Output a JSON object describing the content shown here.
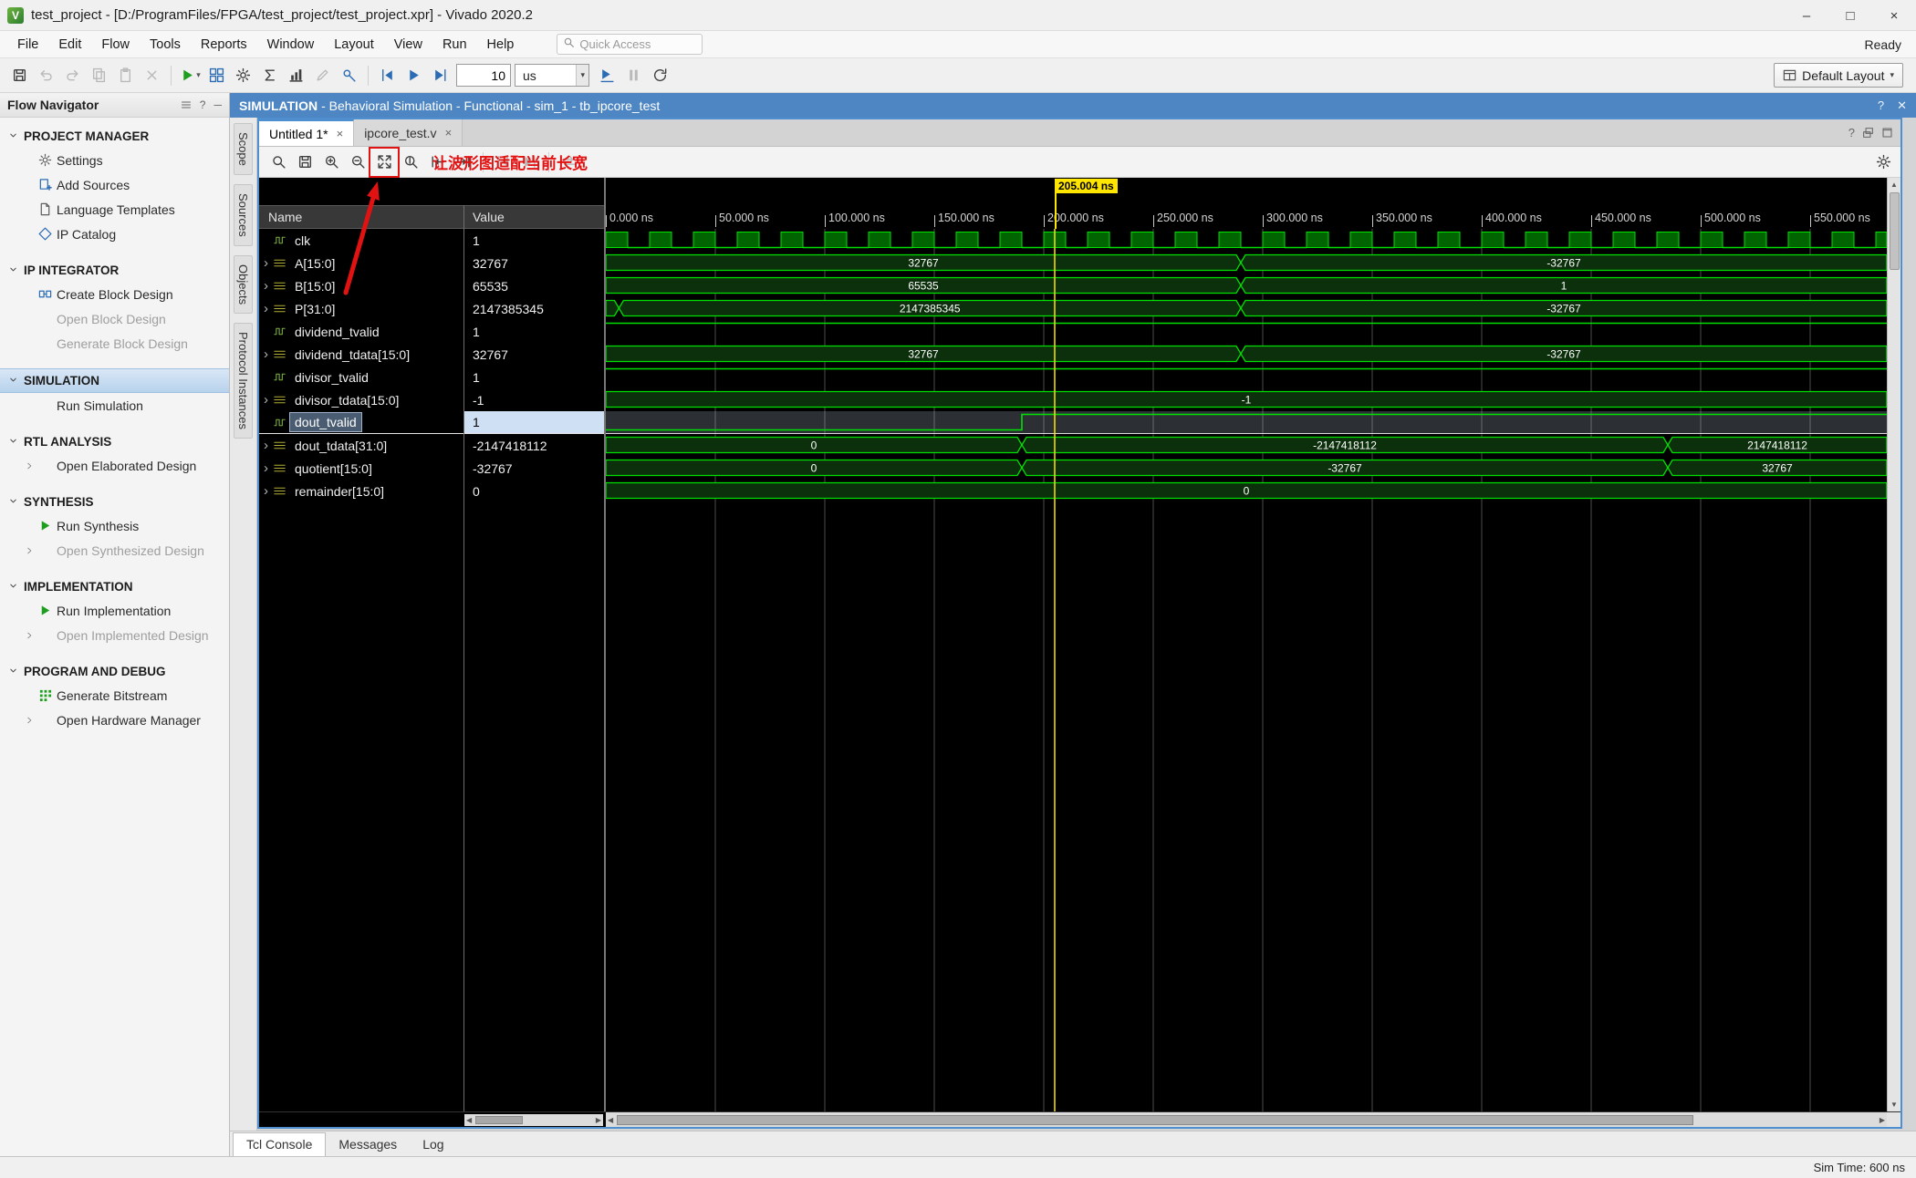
{
  "window": {
    "title": "test_project - [D:/ProgramFiles/FPGA/test_project/test_project.xpr] - Vivado 2020.2",
    "status": "Ready",
    "controls": {
      "minimize": "–",
      "maximize": "□",
      "close": "×"
    }
  },
  "menu": {
    "items": [
      "File",
      "Edit",
      "Flow",
      "Tools",
      "Reports",
      "Window",
      "Layout",
      "View",
      "Run",
      "Help"
    ],
    "quick_access": "Quick Access"
  },
  "toolbar": {
    "sim_time_value": "10",
    "sim_time_unit": "us",
    "layout_label": "Default Layout",
    "buttons": [
      {
        "icon": "save",
        "name": "save"
      },
      {
        "icon": "undo",
        "name": "undo",
        "disabled": true
      },
      {
        "icon": "redo",
        "name": "redo",
        "disabled": true
      },
      {
        "icon": "copy",
        "name": "copy",
        "disabled": true
      },
      {
        "icon": "paste",
        "name": "paste",
        "disabled": true
      },
      {
        "icon": "del",
        "name": "delete",
        "disabled": true
      },
      {
        "sep": true
      },
      {
        "icon": "play",
        "name": "run",
        "color": "green",
        "dropdown": true
      },
      {
        "icon": "dash",
        "name": "dashboard",
        "color": "blue"
      },
      {
        "icon": "gear",
        "name": "settings"
      },
      {
        "icon": "sigma",
        "name": "report-summary"
      },
      {
        "icon": "report",
        "name": "report-metrics"
      },
      {
        "icon": "pencil",
        "name": "edit",
        "disabled": true
      },
      {
        "icon": "probe",
        "name": "probe",
        "color": "blue"
      },
      {
        "sep": true
      },
      {
        "icon": "restart",
        "name": "restart-simulation",
        "color": "blue"
      },
      {
        "icon": "play",
        "name": "run-all",
        "color": "blue"
      },
      {
        "icon": "step",
        "name": "step",
        "color": "blue"
      },
      {
        "input": "10"
      },
      {
        "unit": "us"
      },
      {
        "icon": "runfor",
        "name": "run-for-time",
        "color": "blue"
      },
      {
        "icon": "pause",
        "name": "pause",
        "disabled": true
      },
      {
        "icon": "relaunch",
        "name": "relaunch-simulation"
      }
    ]
  },
  "sim_header": {
    "title": "SIMULATION",
    "subtitle": "- Behavioral Simulation - Functional - sim_1 - tb_ipcore_test"
  },
  "flow_navigator": {
    "title": "Flow Navigator",
    "sections": [
      {
        "label": "PROJECT MANAGER",
        "items": [
          {
            "label": "Settings",
            "icon": "gear",
            "color": "gray"
          },
          {
            "label": "Add Sources",
            "icon": "plusdoc",
            "color": "blue"
          },
          {
            "label": "Language Templates",
            "icon": "doc",
            "color": "gray"
          },
          {
            "label": "IP Catalog",
            "icon": "ip",
            "color": "blue"
          }
        ]
      },
      {
        "label": "IP INTEGRATOR",
        "items": [
          {
            "label": "Create Block Design",
            "icon": "block",
            "color": "blue"
          },
          {
            "label": "Open Block Design",
            "disabled": true
          },
          {
            "label": "Generate Block Design",
            "disabled": true
          }
        ]
      },
      {
        "label": "SIMULATION",
        "selected": true,
        "items": [
          {
            "label": "Run Simulation"
          }
        ]
      },
      {
        "label": "RTL ANALYSIS",
        "items": [
          {
            "label": "Open Elaborated Design",
            "chevron": true
          }
        ]
      },
      {
        "label": "SYNTHESIS",
        "items": [
          {
            "label": "Run Synthesis",
            "icon": "play",
            "color": "green"
          },
          {
            "label": "Open Synthesized Design",
            "chevron": true,
            "disabled": true
          }
        ]
      },
      {
        "label": "IMPLEMENTATION",
        "items": [
          {
            "label": "Run Implementation",
            "icon": "play",
            "color": "green"
          },
          {
            "label": "Open Implemented Design",
            "chevron": true,
            "disabled": true
          }
        ]
      },
      {
        "label": "PROGRAM AND DEBUG",
        "items": [
          {
            "label": "Generate Bitstream",
            "icon": "bitstream",
            "color": "green"
          },
          {
            "label": "Open Hardware Manager",
            "chevron": true
          }
        ]
      }
    ]
  },
  "wave": {
    "tabs": [
      {
        "label": "Untitled 1*",
        "active": true
      },
      {
        "label": "ipcore_test.v",
        "active": false
      }
    ],
    "side_tabs": [
      "Scope",
      "Sources",
      "Objects",
      "Protocol Instances"
    ],
    "annotation": {
      "text": "让波形图适配当前长宽"
    },
    "toolbar_buttons": [
      {
        "icon": "mag",
        "name": "find"
      },
      {
        "icon": "save",
        "name": "save-waveform"
      },
      {
        "icon": "zoomin",
        "name": "zoom-in"
      },
      {
        "icon": "zoomout",
        "name": "zoom-out"
      },
      {
        "icon": "zoomfit",
        "name": "zoom-fit",
        "annotated": true
      },
      {
        "icon": "zoomcur",
        "name": "zoom-to-cursor"
      },
      {
        "icon": "arrbarL",
        "name": "previous-transition"
      },
      {
        "icon": "arrbarR",
        "name": "next-transition"
      },
      {
        "sep": true
      },
      {
        "icon": "restart",
        "name": "go-to-time-0",
        "disabled": true
      },
      {
        "icon": "step",
        "name": "go-to-last-time",
        "disabled": true
      },
      {
        "sep": true
      },
      {
        "icon": "swap",
        "name": "swap-cursor",
        "disabled": true
      }
    ],
    "columns": [
      "Name",
      "Value"
    ],
    "signals": [
      {
        "name": "clk",
        "value": "1",
        "kind": "clock",
        "period": 20
      },
      {
        "name": "A[15:0]",
        "value": "32767",
        "kind": "bus",
        "segments": [
          {
            "t": 0,
            "label": "32767"
          },
          {
            "t": 290,
            "label": "-32767"
          }
        ]
      },
      {
        "name": "B[15:0]",
        "value": "65535",
        "kind": "bus",
        "segments": [
          {
            "t": 0,
            "label": "65535"
          },
          {
            "t": 290,
            "label": "1"
          }
        ]
      },
      {
        "name": "P[31:0]",
        "value": "2147385345",
        "kind": "bus",
        "segments": [
          {
            "t": 0,
            "label": ""
          },
          {
            "t": 6,
            "label": "2147385345"
          },
          {
            "t": 290,
            "label": "-32767"
          }
        ]
      },
      {
        "name": "dividend_tvalid",
        "value": "1",
        "kind": "bit",
        "segments": [
          {
            "t": 0,
            "level": 1
          }
        ]
      },
      {
        "name": "dividend_tdata[15:0]",
        "value": "32767",
        "kind": "bus",
        "segments": [
          {
            "t": 0,
            "label": "32767"
          },
          {
            "t": 290,
            "label": "-32767"
          }
        ]
      },
      {
        "name": "divisor_tvalid",
        "value": "1",
        "kind": "bit",
        "segments": [
          {
            "t": 0,
            "level": 1
          }
        ]
      },
      {
        "name": "divisor_tdata[15:0]",
        "value": "-1",
        "kind": "bus",
        "segments": [
          {
            "t": 0,
            "label": "-1"
          }
        ]
      },
      {
        "name": "dout_tvalid",
        "value": "1",
        "kind": "bit",
        "selected": true,
        "segments": [
          {
            "t": 0,
            "level": 0
          },
          {
            "t": 190,
            "level": 1
          }
        ]
      },
      {
        "name": "dout_tdata[31:0]",
        "value": "-2147418112",
        "kind": "bus",
        "segments": [
          {
            "t": 0,
            "label": "0"
          },
          {
            "t": 190,
            "label": "-2147418112"
          },
          {
            "t": 485,
            "label": "2147418112"
          }
        ]
      },
      {
        "name": "quotient[15:0]",
        "value": "-32767",
        "kind": "bus",
        "segments": [
          {
            "t": 0,
            "label": "0"
          },
          {
            "t": 190,
            "label": "-32767"
          },
          {
            "t": 485,
            "label": "32767"
          }
        ]
      },
      {
        "name": "remainder[15:0]",
        "value": "0",
        "kind": "bus",
        "segments": [
          {
            "t": 0,
            "label": "0"
          }
        ]
      }
    ],
    "timeline": {
      "unit": "ns",
      "t_end": 585,
      "step": 50,
      "labels": [
        "0.000 ns",
        "50.000 ns",
        "100.000 ns",
        "150.000 ns",
        "200.000 ns",
        "250.000 ns",
        "300.000 ns",
        "350.000 ns",
        "400.000 ns",
        "450.000 ns",
        "500.000 ns",
        "550.000 ns"
      ],
      "cursor": {
        "time": 205.004,
        "label": "205.004 ns"
      }
    }
  },
  "bottom_tabs": [
    "Tcl Console",
    "Messages",
    "Log"
  ],
  "status": {
    "sim_time": "Sim Time: 600 ns"
  }
}
